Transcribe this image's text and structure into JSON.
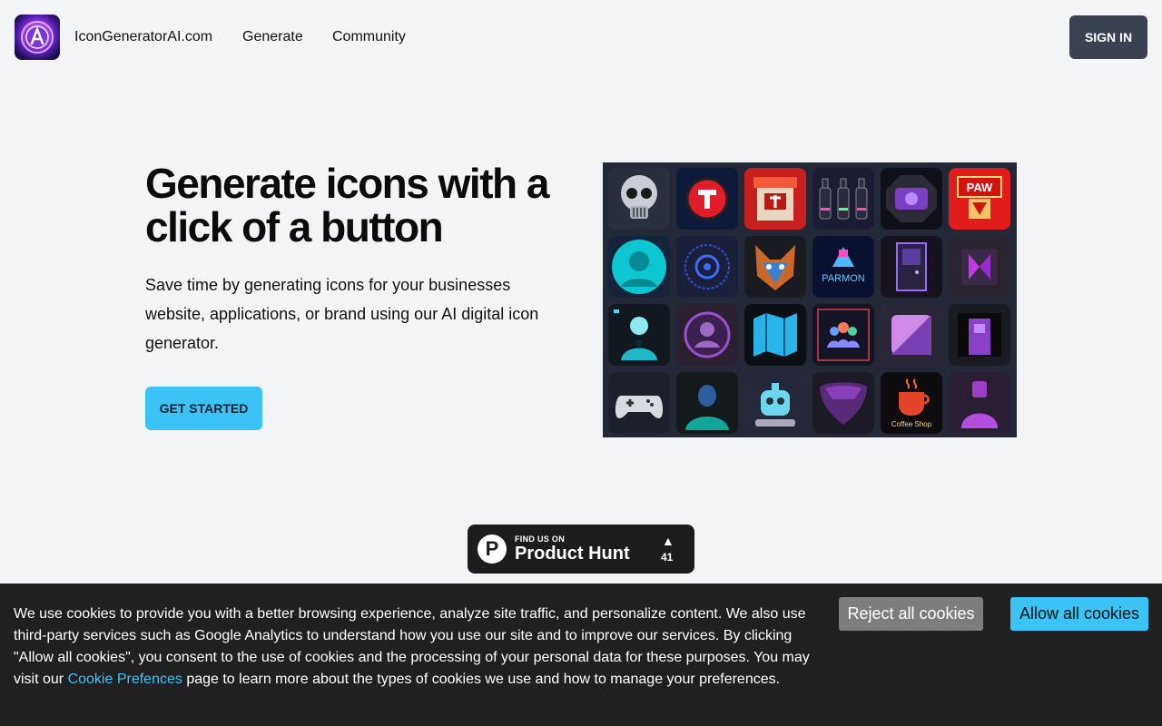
{
  "header": {
    "brand": "IconGeneratorAI.com",
    "nav": [
      {
        "label": "Generate"
      },
      {
        "label": "Community"
      }
    ],
    "signin_label": "SIGN IN"
  },
  "hero": {
    "title": "Generate icons with a click of a button",
    "subtitle": "Save time by generating icons for your businesses website, applications, or brand using our AI digital icon generator.",
    "cta_label": "GET STARTED",
    "tiles": [
      {
        "name": "skull-icon"
      },
      {
        "name": "t-logo-icon"
      },
      {
        "name": "red-booth-icon"
      },
      {
        "name": "bottles-icon"
      },
      {
        "name": "purple-gem-icon"
      },
      {
        "name": "paw-sign-icon",
        "text": "PAW"
      },
      {
        "name": "cyan-avatar-icon"
      },
      {
        "name": "gear-circle-icon"
      },
      {
        "name": "fox-icon"
      },
      {
        "name": "parmon-logo-icon",
        "text": "PARMON"
      },
      {
        "name": "door-icon"
      },
      {
        "name": "purple-diamond-icon"
      },
      {
        "name": "cyan-man-icon"
      },
      {
        "name": "purple-portrait-icon"
      },
      {
        "name": "map-icon"
      },
      {
        "name": "people-group-icon"
      },
      {
        "name": "purple-square-icon"
      },
      {
        "name": "building-icon"
      },
      {
        "name": "gamepad-icon"
      },
      {
        "name": "teal-person-icon"
      },
      {
        "name": "robot-icon"
      },
      {
        "name": "purple-shield-icon"
      },
      {
        "name": "coffee-shop-icon",
        "text": "Coffee Shop"
      },
      {
        "name": "purple-bust-icon"
      }
    ]
  },
  "product_hunt": {
    "small_label": "FIND US ON",
    "big_label": "Product Hunt",
    "logo_letter": "P",
    "arrow": "▲",
    "count": "41"
  },
  "cookie_banner": {
    "text_before": "We use cookies to provide you with a better browsing experience, analyze site traffic, and personalize content. We also use third-party services such as Google Analytics to understand how you use our site and to improve our services. By clicking \"Allow all cookies\", you consent to the use of cookies and the processing of your personal data for these purposes. You may visit our ",
    "link_label": "Cookie Prefences",
    "text_after": " page to learn more about the types of cookies we use and how to manage your preferences.",
    "reject_label": "Reject all cookies",
    "allow_label": "Allow all cookies"
  },
  "colors": {
    "accent": "#3cc3f6",
    "signin_bg": "#3a4150",
    "page_bg": "#f3f4f6",
    "banner_bg": "#202020"
  }
}
